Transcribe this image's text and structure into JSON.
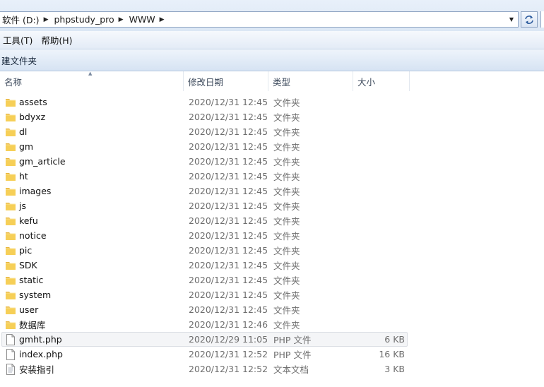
{
  "address_bar": {
    "crumbs": [
      "软件 (D:)",
      "phpstudy_pro",
      "WWW"
    ]
  },
  "menu": [
    "工具(T)",
    "帮助(H)"
  ],
  "command_bar": {
    "new_folder": "建文件夹"
  },
  "columns": {
    "name": "名称",
    "date": "修改日期",
    "type": "类型",
    "size": "大小"
  },
  "files": [
    {
      "name": "assets",
      "date": "2020/12/31 12:45",
      "type": "文件夹",
      "size": "",
      "icon": "folder-icon"
    },
    {
      "name": "bdyxz",
      "date": "2020/12/31 12:45",
      "type": "文件夹",
      "size": "",
      "icon": "folder-icon"
    },
    {
      "name": "dl",
      "date": "2020/12/31 12:45",
      "type": "文件夹",
      "size": "",
      "icon": "folder-icon"
    },
    {
      "name": "gm",
      "date": "2020/12/31 12:45",
      "type": "文件夹",
      "size": "",
      "icon": "folder-icon"
    },
    {
      "name": "gm_article",
      "date": "2020/12/31 12:45",
      "type": "文件夹",
      "size": "",
      "icon": "folder-icon"
    },
    {
      "name": "ht",
      "date": "2020/12/31 12:45",
      "type": "文件夹",
      "size": "",
      "icon": "folder-icon"
    },
    {
      "name": "images",
      "date": "2020/12/31 12:45",
      "type": "文件夹",
      "size": "",
      "icon": "folder-icon"
    },
    {
      "name": "js",
      "date": "2020/12/31 12:45",
      "type": "文件夹",
      "size": "",
      "icon": "folder-icon"
    },
    {
      "name": "kefu",
      "date": "2020/12/31 12:45",
      "type": "文件夹",
      "size": "",
      "icon": "folder-icon"
    },
    {
      "name": "notice",
      "date": "2020/12/31 12:45",
      "type": "文件夹",
      "size": "",
      "icon": "folder-icon"
    },
    {
      "name": "pic",
      "date": "2020/12/31 12:45",
      "type": "文件夹",
      "size": "",
      "icon": "folder-icon"
    },
    {
      "name": "SDK",
      "date": "2020/12/31 12:45",
      "type": "文件夹",
      "size": "",
      "icon": "folder-icon"
    },
    {
      "name": "static",
      "date": "2020/12/31 12:45",
      "type": "文件夹",
      "size": "",
      "icon": "folder-icon"
    },
    {
      "name": "system",
      "date": "2020/12/31 12:45",
      "type": "文件夹",
      "size": "",
      "icon": "folder-icon"
    },
    {
      "name": "user",
      "date": "2020/12/31 12:45",
      "type": "文件夹",
      "size": "",
      "icon": "folder-icon"
    },
    {
      "name": "数据库",
      "date": "2020/12/31 12:46",
      "type": "文件夹",
      "size": "",
      "icon": "folder-icon"
    },
    {
      "name": "gmht.php",
      "date": "2020/12/29 11:05",
      "type": "PHP 文件",
      "size": "6 KB",
      "icon": "php-file-icon",
      "selected": true
    },
    {
      "name": "index.php",
      "date": "2020/12/31 12:52",
      "type": "PHP 文件",
      "size": "16 KB",
      "icon": "php-file-icon"
    },
    {
      "name": "安装指引",
      "date": "2020/12/31 12:52",
      "type": "文本文档",
      "size": "3 KB",
      "icon": "text-file-icon"
    }
  ]
}
